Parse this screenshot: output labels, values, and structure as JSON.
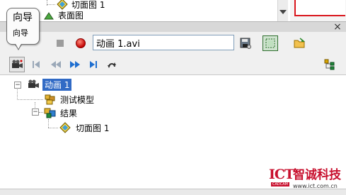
{
  "top_tree": {
    "item_label": "切面图 1",
    "item2_label": "表面图"
  },
  "callout": {
    "title": "向导",
    "subtitle": "向导"
  },
  "toolbar": {
    "filename": "动画 1.avi"
  },
  "tree": {
    "root": "动画 1",
    "children": [
      {
        "label": "测试模型"
      },
      {
        "label": "结果",
        "children": [
          {
            "label": "切面图 1"
          }
        ]
      }
    ]
  },
  "watermark": {
    "logo_text": "ICT",
    "logo_sub": "CADCAM",
    "brand": "智诚科技",
    "url": "www.ict.com.cn"
  },
  "colors": {
    "selection": "#316ac5",
    "watermark_red": "#c8102e",
    "record_red": "#d40000",
    "play_blue": "#1f6fd0"
  }
}
